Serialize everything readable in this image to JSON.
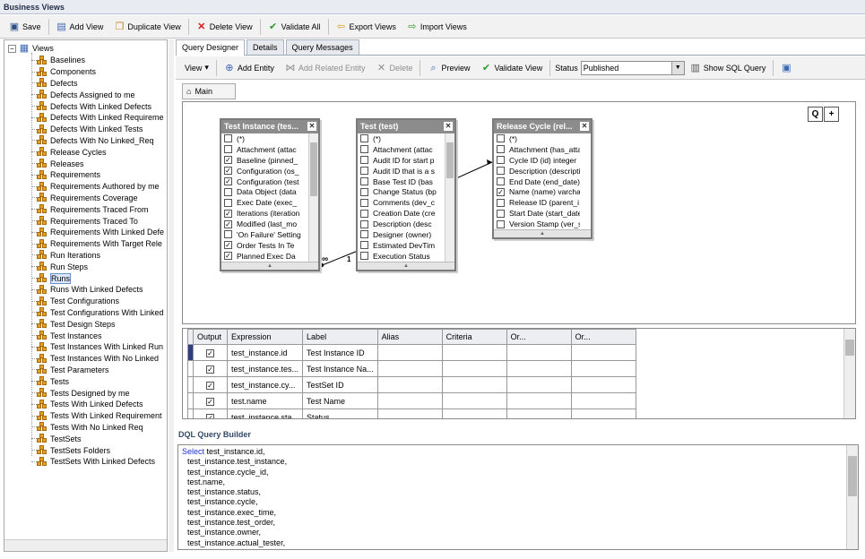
{
  "window": {
    "title": "Business Views"
  },
  "toolbar": {
    "save": "Save",
    "add_view": "Add View",
    "duplicate_view": "Duplicate View",
    "delete_view": "Delete View",
    "validate_all": "Validate All",
    "export_views": "Export Views",
    "import_views": "Import Views"
  },
  "tree": {
    "root": "Views",
    "items": [
      "Baselines",
      "Components",
      "Defects",
      "Defects Assigned to me",
      "Defects With Linked Defects",
      "Defects With Linked Requireme",
      "Defects With Linked Tests",
      "Defects With No Linked_Req",
      "Release Cycles",
      "Releases",
      "Requirements",
      "Requirements Authored by me",
      "Requirements Coverage",
      "Requirements Traced From",
      "Requirements Traced To",
      "Requirements With Linked Defe",
      "Requirements With Target Rele",
      "Run Iterations",
      "Run Steps",
      "Runs",
      "Runs With Linked Defects",
      "Test Configurations",
      "Test Configurations With Linked",
      "Test Design Steps",
      "Test Instances",
      "Test Instances With Linked Run",
      "Test Instances With No Linked",
      "Test Parameters",
      "Tests",
      "Tests Designed by me",
      "Tests With Linked Defects",
      "Tests With Linked Requirement",
      "Tests With No Linked Req",
      "TestSets",
      "TestSets Folders",
      "TestSets With Linked Defects"
    ],
    "selected": "Runs"
  },
  "tabs": [
    "Query Designer",
    "Details",
    "Query Messages"
  ],
  "designer_toolbar": {
    "view": "View",
    "add_entity": "Add Entity",
    "add_related_entity": "Add Related Entity",
    "delete": "Delete",
    "preview": "Preview",
    "validate_view": "Validate View",
    "status_label": "Status",
    "status_value": "Published",
    "show_sql": "Show SQL Query"
  },
  "canvas_tab": "Main",
  "zoom": {
    "q": "Q",
    "plus": "+"
  },
  "entities": [
    {
      "title": "Test Instance (tes...",
      "rows": [
        {
          "t": "(*)",
          "c": false
        },
        {
          "t": "Attachment (attac",
          "c": false
        },
        {
          "t": "Baseline (pinned_",
          "c": true
        },
        {
          "t": "Configuration (os_",
          "c": true
        },
        {
          "t": "Configuration (test",
          "c": true
        },
        {
          "t": "Data Object (data",
          "c": false
        },
        {
          "t": "Exec Date (exec_",
          "c": false
        },
        {
          "t": "Iterations (iteration",
          "c": true
        },
        {
          "t": "Modified (last_mo",
          "c": true
        },
        {
          "t": "'On Failure' Setting",
          "c": false
        },
        {
          "t": "Order Tests In Te",
          "c": true
        },
        {
          "t": "Planned Exec Da",
          "c": true
        }
      ]
    },
    {
      "title": "Test (test)",
      "rows": [
        {
          "t": "(*)",
          "c": false
        },
        {
          "t": "Attachment (attac",
          "c": false
        },
        {
          "t": "Audit ID for start p",
          "c": false
        },
        {
          "t": "Audit ID that is a s",
          "c": false
        },
        {
          "t": "Base Test ID (bas",
          "c": false
        },
        {
          "t": "Change Status (bp",
          "c": false
        },
        {
          "t": "Comments (dev_c",
          "c": false
        },
        {
          "t": "Creation Date (cre",
          "c": false
        },
        {
          "t": "Description (desc",
          "c": false
        },
        {
          "t": "Designer (owner)",
          "c": false
        },
        {
          "t": "Estimated DevTim",
          "c": false
        },
        {
          "t": "Execution Status",
          "c": false
        }
      ]
    },
    {
      "title": "Release Cycle (rel...",
      "rows": [
        {
          "t": "(*)",
          "c": false
        },
        {
          "t": "Attachment (has_atta",
          "c": false
        },
        {
          "t": "Cycle ID (id) integer",
          "c": false
        },
        {
          "t": "Description (descripti",
          "c": false
        },
        {
          "t": "End Date (end_date)",
          "c": false
        },
        {
          "t": "Name (name) varcha",
          "c": true
        },
        {
          "t": "Release ID (parent_i",
          "c": false
        },
        {
          "t": "Start Date (start_date",
          "c": false
        },
        {
          "t": "Version Stamp (ver_s",
          "c": false
        }
      ]
    }
  ],
  "relations": {
    "many": "∞",
    "one": "1"
  },
  "grid": {
    "headers": [
      "Output",
      "Expression",
      "Label",
      "Alias",
      "Criteria",
      "Or...",
      "Or..."
    ],
    "rows": [
      {
        "expr": "test_instance.id",
        "label": "Test Instance ID"
      },
      {
        "expr": "test_instance.tes...",
        "label": "Test Instance Na..."
      },
      {
        "expr": "test_instance.cy...",
        "label": "TestSet ID"
      },
      {
        "expr": "test.name",
        "label": "Test Name"
      },
      {
        "expr": "test_instance.sta...",
        "label": "Status"
      }
    ]
  },
  "dql": {
    "title": "DQL Query Builder",
    "keyword": "Select",
    "first": " test_instance.id,",
    "lines": [
      "test_instance.test_instance,",
      "test_instance.cycle_id,",
      "test.name,",
      "test_instance.status,",
      "test_instance.cycle,",
      "test_instance.exec_time,",
      "test_instance.test_order,",
      "test_instance.owner,",
      "test_instance.actual_tester,"
    ]
  }
}
